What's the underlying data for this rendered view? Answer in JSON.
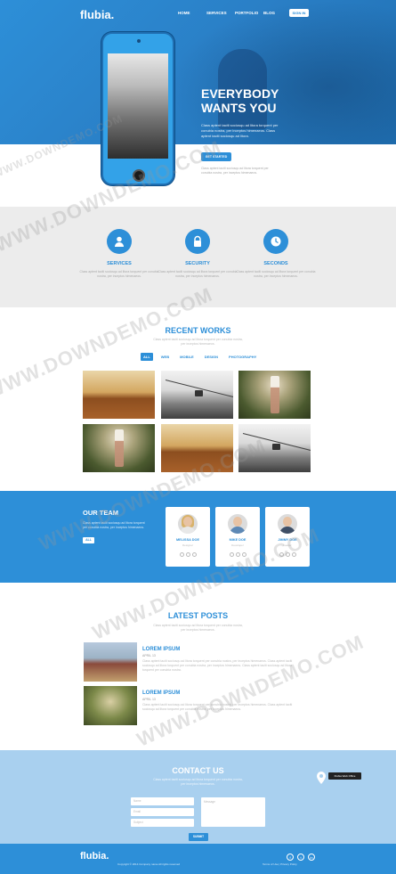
{
  "header": {
    "logo": "flubia.",
    "nav": [
      "HOME",
      "SERVICES",
      "PORTFOLIO",
      "BLOG"
    ],
    "nav_button": "SIGN IN"
  },
  "hero": {
    "title_line1": "EVERYBODY",
    "title_line2": "WANTS YOU",
    "description": "Class aptent taciti sociosqu ad litora torquent per conubia nostra, per inceptos himenaeos. Class aptent taciti sociosqu ad litora.",
    "cta_label": "GET STARTED",
    "cta_note": "Class aptent taciti sociosqu ad litora torquent per conubia nostra, per inceptos himenaeos."
  },
  "features": [
    {
      "title": "SERVICES",
      "icon": "user-icon",
      "text": "Class aptent taciti sociosqu ad litora torquent per conubia nostra, per inceptos himenaeos."
    },
    {
      "title": "SECURITY",
      "icon": "lock-icon",
      "text": "Class aptent taciti sociosqu ad litora torquent per conubia nostra, per inceptos himenaeos."
    },
    {
      "title": "SECONDS",
      "icon": "clock-icon",
      "text": "Class aptent taciti sociosqu ad litora torquent per conubia nostra, per inceptos himenaeos."
    }
  ],
  "works": {
    "title": "RECENT WORKS",
    "description": "Class aptent taciti sociosqu ad litora torquent per conubia nostra, per inceptos himenaeos.",
    "filters": [
      "ALL",
      "WEB",
      "MOBILE",
      "DESIGN",
      "PHOTOGRAPHY"
    ],
    "active_filter": "ALL"
  },
  "team": {
    "title": "OUR TEAM",
    "description": "Class aptent taciti sociosqu ad litora torquent per conubia nostra, per inceptos himenaeos.",
    "button": "ALL",
    "members": [
      {
        "name": "MELISSA DOE",
        "role": "Designer"
      },
      {
        "name": "MIKE DOE",
        "role": "Developer"
      },
      {
        "name": "JIMMY DOE",
        "role": "Leader"
      }
    ]
  },
  "posts": {
    "title": "LATEST POSTS",
    "description": "Class aptent taciti sociosqu ad litora torquent per conubia nostra, per inceptos himenaeos.",
    "items": [
      {
        "title": "LOREM IPSUM",
        "date": "APRIL 13",
        "text": "Class aptent taciti sociosqu ad litora torquent per conubia nostra, per inceptos himenaeos. Class aptent taciti sociosqu ad litora torquent per conubia nostra, per inceptos himenaeos. Class aptent taciti sociosqu ad litora torquent per conubia nostra."
      },
      {
        "title": "LOREM IPSUM",
        "date": "APRIL 13",
        "text": "Class aptent taciti sociosqu ad litora torquent per conubia nostra, per inceptos himenaeos. Class aptent taciti sociosqu ad litora torquent per conubia nostra, per inceptos himenaeos."
      }
    ]
  },
  "contact": {
    "title": "CONTACT US",
    "description": "Class aptent taciti sociosqu ad litora torquent per conubia nostra, per inceptos himenaeos.",
    "name_placeholder": "Name",
    "email_placeholder": "Email",
    "subject_placeholder": "Subject",
    "message_placeholder": "Message",
    "submit": "SUBMIT",
    "map_label": "Flubia Web Office"
  },
  "footer": {
    "logo": "flubia.",
    "copyright": "Copyright © 2014 Company name All rights reserved",
    "links": "Terms of Use | Privacy Policy",
    "social": [
      "f",
      "t",
      "in"
    ]
  },
  "watermark": "WWW.DOWNDEMO.COM"
}
